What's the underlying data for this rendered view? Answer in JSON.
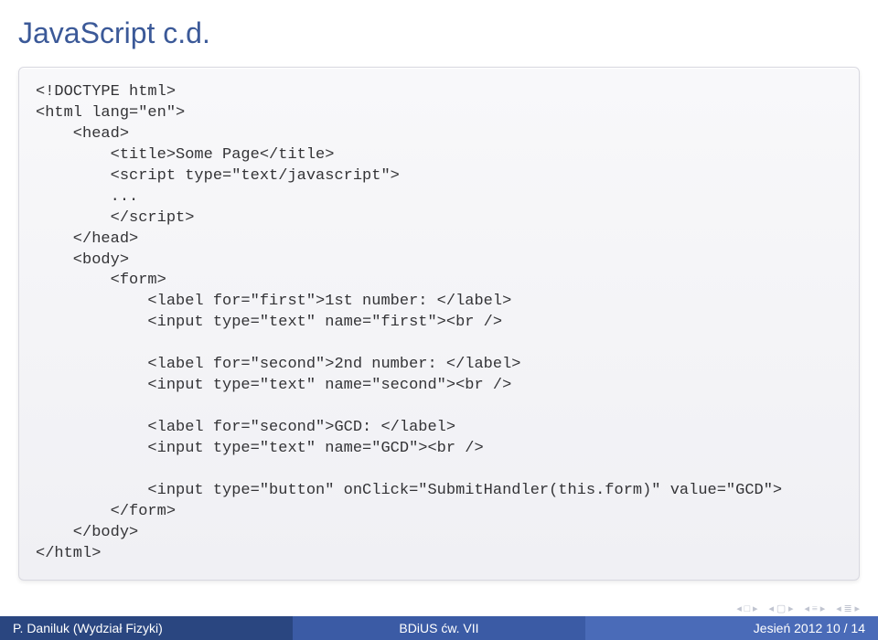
{
  "title": "JavaScript c.d.",
  "code": "<!DOCTYPE html>\n<html lang=\"en\">\n    <head>\n        <title>Some Page</title>\n        <script type=\"text/javascript\">\n        ...\n        </script>\n    </head>\n    <body>\n        <form>\n            <label for=\"first\">1st number: </label>\n            <input type=\"text\" name=\"first\"><br />\n\n            <label for=\"second\">2nd number: </label>\n            <input type=\"text\" name=\"second\"><br />\n\n            <label for=\"second\">GCD: </label>\n            <input type=\"text\" name=\"GCD\"><br />\n\n            <input type=\"button\" onClick=\"SubmitHandler(this.form)\" value=\"GCD\">\n        </form>\n    </body>\n</html>",
  "footer": {
    "left": "P. Daniluk (Wydział Fizyki)",
    "center": "BDiUS ćw. VII",
    "right": "Jesień 2012    10 / 14"
  }
}
